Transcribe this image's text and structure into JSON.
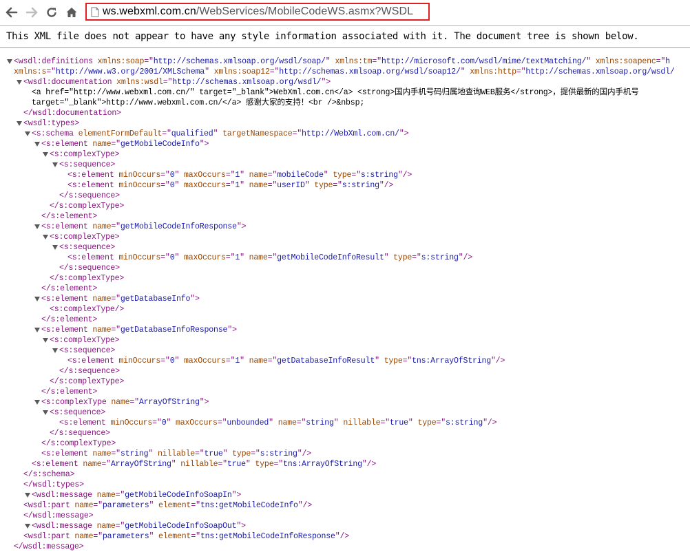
{
  "browser": {
    "url_host": "ws.webxml.com.cn",
    "url_path": "/WebServices/MobileCodeWS.asmx?WSDL",
    "back_icon": "back-arrow-icon",
    "forward_icon": "forward-arrow-icon",
    "reload_icon": "reload-icon",
    "home_icon": "home-icon",
    "highlight_color": "#e02020"
  },
  "notice": "This XML file does not appear to have any style information associated with it. The document tree is shown below.",
  "colors": {
    "tag": "#881280",
    "attr_name": "#994500",
    "attr_value": "#1a1aa6",
    "text": "#000000"
  },
  "tree": [
    {
      "tri": true,
      "parts": [
        [
          "tag",
          "<wsdl:definitions"
        ],
        [
          "tx",
          " "
        ],
        [
          "an",
          "xmlns:soap"
        ],
        [
          "tag",
          "=\""
        ],
        [
          "av",
          "http://schemas.xmlsoap.org/wsdl/soap/"
        ],
        [
          "tag",
          "\""
        ],
        [
          "tx",
          " "
        ],
        [
          "an",
          "xmlns:tm"
        ],
        [
          "tag",
          "=\""
        ],
        [
          "av",
          "http://microsoft.com/wsdl/mime/textMatching/"
        ],
        [
          "tag",
          "\""
        ],
        [
          "tx",
          " "
        ],
        [
          "an",
          "xmlns:soapenc"
        ],
        [
          "tag",
          "=\""
        ],
        [
          "av",
          "h"
        ]
      ]
    },
    {
      "tri": false,
      "parts": [
        [
          "an",
          "xmlns:s"
        ],
        [
          "tag",
          "=\""
        ],
        [
          "av",
          "http://www.w3.org/2001/XMLSchema"
        ],
        [
          "tag",
          "\""
        ],
        [
          "tx",
          " "
        ],
        [
          "an",
          "xmlns:soap12"
        ],
        [
          "tag",
          "=\""
        ],
        [
          "av",
          "http://schemas.xmlsoap.org/wsdl/soap12/"
        ],
        [
          "tag",
          "\""
        ],
        [
          "tx",
          " "
        ],
        [
          "an",
          "xmlns:http"
        ],
        [
          "tag",
          "=\""
        ],
        [
          "av",
          "http://schemas.xmlsoap.org/wsdl/"
        ]
      ]
    },
    {
      "tri": true,
      "parts": [
        [
          "tag",
          "<wsdl:documentation"
        ],
        [
          "tx",
          " "
        ],
        [
          "an",
          "xmlns:wsdl"
        ],
        [
          "tag",
          "=\""
        ],
        [
          "av",
          "http://schemas.xmlsoap.org/wsdl/"
        ],
        [
          "tag",
          "\">"
        ]
      ]
    },
    {
      "tri": false,
      "parts": [
        [
          "tx",
          "<a href=\"http://www.webxml.com.cn/\" target=\"_blank\">WebXml.com.cn</a> <strong>国内手机号码归属地查询WEB服务</strong>，提供最新的国内手机号"
        ]
      ]
    },
    {
      "tri": false,
      "parts": [
        [
          "tx",
          "target=\"_blank\">http://www.webxml.com.cn/</a> 感谢大家的支持！<br />&nbsp;"
        ]
      ]
    },
    {
      "tri": false,
      "parts": [
        [
          "tag",
          "</wsdl:documentation>"
        ]
      ]
    },
    {
      "tri": true,
      "parts": [
        [
          "tag",
          "<wsdl:types>"
        ]
      ]
    },
    {
      "tri": true,
      "parts": [
        [
          "tag",
          "<s:schema"
        ],
        [
          "tx",
          " "
        ],
        [
          "an",
          "elementFormDefault"
        ],
        [
          "tag",
          "=\""
        ],
        [
          "av",
          "qualified"
        ],
        [
          "tag",
          "\""
        ],
        [
          "tx",
          " "
        ],
        [
          "an",
          "targetNamespace"
        ],
        [
          "tag",
          "=\""
        ],
        [
          "av",
          "http://WebXml.com.cn/"
        ],
        [
          "tag",
          "\">"
        ]
      ]
    },
    {
      "tri": true,
      "parts": [
        [
          "tag",
          "<s:element"
        ],
        [
          "tx",
          " "
        ],
        [
          "an",
          "name"
        ],
        [
          "tag",
          "=\""
        ],
        [
          "av",
          "getMobileCodeInfo"
        ],
        [
          "tag",
          "\">"
        ]
      ]
    },
    {
      "tri": true,
      "parts": [
        [
          "tag",
          "<s:complexType>"
        ]
      ]
    },
    {
      "tri": true,
      "parts": [
        [
          "tag",
          "<s:sequence>"
        ]
      ]
    },
    {
      "tri": false,
      "parts": [
        [
          "tag",
          "<s:element"
        ],
        [
          "tx",
          " "
        ],
        [
          "an",
          "minOccurs"
        ],
        [
          "tag",
          "=\""
        ],
        [
          "av",
          "0"
        ],
        [
          "tag",
          "\""
        ],
        [
          "tx",
          " "
        ],
        [
          "an",
          "maxOccurs"
        ],
        [
          "tag",
          "=\""
        ],
        [
          "av",
          "1"
        ],
        [
          "tag",
          "\""
        ],
        [
          "tx",
          " "
        ],
        [
          "an",
          "name"
        ],
        [
          "tag",
          "=\""
        ],
        [
          "av",
          "mobileCode"
        ],
        [
          "tag",
          "\""
        ],
        [
          "tx",
          " "
        ],
        [
          "an",
          "type"
        ],
        [
          "tag",
          "=\""
        ],
        [
          "av",
          "s:string"
        ],
        [
          "tag",
          "\"/>"
        ]
      ]
    },
    {
      "tri": false,
      "parts": [
        [
          "tag",
          "<s:element"
        ],
        [
          "tx",
          " "
        ],
        [
          "an",
          "minOccurs"
        ],
        [
          "tag",
          "=\""
        ],
        [
          "av",
          "0"
        ],
        [
          "tag",
          "\""
        ],
        [
          "tx",
          " "
        ],
        [
          "an",
          "maxOccurs"
        ],
        [
          "tag",
          "=\""
        ],
        [
          "av",
          "1"
        ],
        [
          "tag",
          "\""
        ],
        [
          "tx",
          " "
        ],
        [
          "an",
          "name"
        ],
        [
          "tag",
          "=\""
        ],
        [
          "av",
          "userID"
        ],
        [
          "tag",
          "\""
        ],
        [
          "tx",
          " "
        ],
        [
          "an",
          "type"
        ],
        [
          "tag",
          "=\""
        ],
        [
          "av",
          "s:string"
        ],
        [
          "tag",
          "\"/>"
        ]
      ]
    },
    {
      "tri": false,
      "parts": [
        [
          "tag",
          "</s:sequence>"
        ]
      ]
    },
    {
      "tri": false,
      "parts": [
        [
          "tag",
          "</s:complexType>"
        ]
      ]
    },
    {
      "tri": false,
      "parts": [
        [
          "tag",
          "</s:element>"
        ]
      ]
    },
    {
      "tri": true,
      "parts": [
        [
          "tag",
          "<s:element"
        ],
        [
          "tx",
          " "
        ],
        [
          "an",
          "name"
        ],
        [
          "tag",
          "=\""
        ],
        [
          "av",
          "getMobileCodeInfoResponse"
        ],
        [
          "tag",
          "\">"
        ]
      ]
    },
    {
      "tri": true,
      "parts": [
        [
          "tag",
          "<s:complexType>"
        ]
      ]
    },
    {
      "tri": true,
      "parts": [
        [
          "tag",
          "<s:sequence>"
        ]
      ]
    },
    {
      "tri": false,
      "parts": [
        [
          "tag",
          "<s:element"
        ],
        [
          "tx",
          " "
        ],
        [
          "an",
          "minOccurs"
        ],
        [
          "tag",
          "=\""
        ],
        [
          "av",
          "0"
        ],
        [
          "tag",
          "\""
        ],
        [
          "tx",
          " "
        ],
        [
          "an",
          "maxOccurs"
        ],
        [
          "tag",
          "=\""
        ],
        [
          "av",
          "1"
        ],
        [
          "tag",
          "\""
        ],
        [
          "tx",
          " "
        ],
        [
          "an",
          "name"
        ],
        [
          "tag",
          "=\""
        ],
        [
          "av",
          "getMobileCodeInfoResult"
        ],
        [
          "tag",
          "\""
        ],
        [
          "tx",
          " "
        ],
        [
          "an",
          "type"
        ],
        [
          "tag",
          "=\""
        ],
        [
          "av",
          "s:string"
        ],
        [
          "tag",
          "\"/>"
        ]
      ]
    },
    {
      "tri": false,
      "parts": [
        [
          "tag",
          "</s:sequence>"
        ]
      ]
    },
    {
      "tri": false,
      "parts": [
        [
          "tag",
          "</s:complexType>"
        ]
      ]
    },
    {
      "tri": false,
      "parts": [
        [
          "tag",
          "</s:element>"
        ]
      ]
    },
    {
      "tri": true,
      "parts": [
        [
          "tag",
          "<s:element"
        ],
        [
          "tx",
          " "
        ],
        [
          "an",
          "name"
        ],
        [
          "tag",
          "=\""
        ],
        [
          "av",
          "getDatabaseInfo"
        ],
        [
          "tag",
          "\">"
        ]
      ]
    },
    {
      "tri": false,
      "parts": [
        [
          "tag",
          "<s:complexType/>"
        ]
      ]
    },
    {
      "tri": false,
      "parts": [
        [
          "tag",
          "</s:element>"
        ]
      ]
    },
    {
      "tri": true,
      "parts": [
        [
          "tag",
          "<s:element"
        ],
        [
          "tx",
          " "
        ],
        [
          "an",
          "name"
        ],
        [
          "tag",
          "=\""
        ],
        [
          "av",
          "getDatabaseInfoResponse"
        ],
        [
          "tag",
          "\">"
        ]
      ]
    },
    {
      "tri": true,
      "parts": [
        [
          "tag",
          "<s:complexType>"
        ]
      ]
    },
    {
      "tri": true,
      "parts": [
        [
          "tag",
          "<s:sequence>"
        ]
      ]
    },
    {
      "tri": false,
      "parts": [
        [
          "tag",
          "<s:element"
        ],
        [
          "tx",
          " "
        ],
        [
          "an",
          "minOccurs"
        ],
        [
          "tag",
          "=\""
        ],
        [
          "av",
          "0"
        ],
        [
          "tag",
          "\""
        ],
        [
          "tx",
          " "
        ],
        [
          "an",
          "maxOccurs"
        ],
        [
          "tag",
          "=\""
        ],
        [
          "av",
          "1"
        ],
        [
          "tag",
          "\""
        ],
        [
          "tx",
          " "
        ],
        [
          "an",
          "name"
        ],
        [
          "tag",
          "=\""
        ],
        [
          "av",
          "getDatabaseInfoResult"
        ],
        [
          "tag",
          "\""
        ],
        [
          "tx",
          " "
        ],
        [
          "an",
          "type"
        ],
        [
          "tag",
          "=\""
        ],
        [
          "av",
          "tns:ArrayOfString"
        ],
        [
          "tag",
          "\"/>"
        ]
      ]
    },
    {
      "tri": false,
      "parts": [
        [
          "tag",
          "</s:sequence>"
        ]
      ]
    },
    {
      "tri": false,
      "parts": [
        [
          "tag",
          "</s:complexType>"
        ]
      ]
    },
    {
      "tri": false,
      "parts": [
        [
          "tag",
          "</s:element>"
        ]
      ]
    },
    {
      "tri": true,
      "parts": [
        [
          "tag",
          "<s:complexType"
        ],
        [
          "tx",
          " "
        ],
        [
          "an",
          "name"
        ],
        [
          "tag",
          "=\""
        ],
        [
          "av",
          "ArrayOfString"
        ],
        [
          "tag",
          "\">"
        ]
      ]
    },
    {
      "tri": true,
      "parts": [
        [
          "tag",
          "<s:sequence>"
        ]
      ]
    },
    {
      "tri": false,
      "parts": [
        [
          "tag",
          "<s:element"
        ],
        [
          "tx",
          " "
        ],
        [
          "an",
          "minOccurs"
        ],
        [
          "tag",
          "=\""
        ],
        [
          "av",
          "0"
        ],
        [
          "tag",
          "\""
        ],
        [
          "tx",
          " "
        ],
        [
          "an",
          "maxOccurs"
        ],
        [
          "tag",
          "=\""
        ],
        [
          "av",
          "unbounded"
        ],
        [
          "tag",
          "\""
        ],
        [
          "tx",
          " "
        ],
        [
          "an",
          "name"
        ],
        [
          "tag",
          "=\""
        ],
        [
          "av",
          "string"
        ],
        [
          "tag",
          "\""
        ],
        [
          "tx",
          " "
        ],
        [
          "an",
          "nillable"
        ],
        [
          "tag",
          "=\""
        ],
        [
          "av",
          "true"
        ],
        [
          "tag",
          "\""
        ],
        [
          "tx",
          " "
        ],
        [
          "an",
          "type"
        ],
        [
          "tag",
          "=\""
        ],
        [
          "av",
          "s:string"
        ],
        [
          "tag",
          "\"/>"
        ]
      ]
    },
    {
      "tri": false,
      "parts": [
        [
          "tag",
          "</s:sequence>"
        ]
      ]
    },
    {
      "tri": false,
      "parts": [
        [
          "tag",
          "</s:complexType>"
        ]
      ]
    },
    {
      "tri": false,
      "parts": [
        [
          "tag",
          "<s:element"
        ],
        [
          "tx",
          " "
        ],
        [
          "an",
          "name"
        ],
        [
          "tag",
          "=\""
        ],
        [
          "av",
          "string"
        ],
        [
          "tag",
          "\""
        ],
        [
          "tx",
          " "
        ],
        [
          "an",
          "nillable"
        ],
        [
          "tag",
          "=\""
        ],
        [
          "av",
          "true"
        ],
        [
          "tag",
          "\""
        ],
        [
          "tx",
          " "
        ],
        [
          "an",
          "type"
        ],
        [
          "tag",
          "=\""
        ],
        [
          "av",
          "s:string"
        ],
        [
          "tag",
          "\"/>"
        ]
      ]
    },
    {
      "tri": false,
      "parts": [
        [
          "tag",
          "<s:element"
        ],
        [
          "tx",
          " "
        ],
        [
          "an",
          "name"
        ],
        [
          "tag",
          "=\""
        ],
        [
          "av",
          "ArrayOfString"
        ],
        [
          "tag",
          "\""
        ],
        [
          "tx",
          " "
        ],
        [
          "an",
          "nillable"
        ],
        [
          "tag",
          "=\""
        ],
        [
          "av",
          "true"
        ],
        [
          "tag",
          "\""
        ],
        [
          "tx",
          " "
        ],
        [
          "an",
          "type"
        ],
        [
          "tag",
          "=\""
        ],
        [
          "av",
          "tns:ArrayOfString"
        ],
        [
          "tag",
          "\"/>"
        ]
      ]
    },
    {
      "tri": false,
      "parts": [
        [
          "tag",
          "</s:schema>"
        ]
      ]
    },
    {
      "tri": false,
      "parts": [
        [
          "tag",
          "</wsdl:types>"
        ]
      ]
    },
    {
      "tri": true,
      "parts": [
        [
          "tag",
          "<wsdl:message"
        ],
        [
          "tx",
          " "
        ],
        [
          "an",
          "name"
        ],
        [
          "tag",
          "=\""
        ],
        [
          "av",
          "getMobileCodeInfoSoapIn"
        ],
        [
          "tag",
          "\">"
        ]
      ]
    },
    {
      "tri": false,
      "parts": [
        [
          "tag",
          "<wsdl:part"
        ],
        [
          "tx",
          " "
        ],
        [
          "an",
          "name"
        ],
        [
          "tag",
          "=\""
        ],
        [
          "av",
          "parameters"
        ],
        [
          "tag",
          "\""
        ],
        [
          "tx",
          " "
        ],
        [
          "an",
          "element"
        ],
        [
          "tag",
          "=\""
        ],
        [
          "av",
          "tns:getMobileCodeInfo"
        ],
        [
          "tag",
          "\"/>"
        ]
      ]
    },
    {
      "tri": false,
      "parts": [
        [
          "tag",
          "</wsdl:message>"
        ]
      ]
    },
    {
      "tri": true,
      "parts": [
        [
          "tag",
          "<wsdl:message"
        ],
        [
          "tx",
          " "
        ],
        [
          "an",
          "name"
        ],
        [
          "tag",
          "=\""
        ],
        [
          "av",
          "getMobileCodeInfoSoapOut"
        ],
        [
          "tag",
          "\">"
        ]
      ]
    },
    {
      "tri": false,
      "parts": [
        [
          "tag",
          "<wsdl:part"
        ],
        [
          "tx",
          " "
        ],
        [
          "an",
          "name"
        ],
        [
          "tag",
          "=\""
        ],
        [
          "av",
          "parameters"
        ],
        [
          "tag",
          "\""
        ],
        [
          "tx",
          " "
        ],
        [
          "an",
          "element"
        ],
        [
          "tag",
          "=\""
        ],
        [
          "av",
          "tns:getMobileCodeInfoResponse"
        ],
        [
          "tag",
          "\"/>"
        ]
      ]
    },
    {
      "tri": false,
      "parts": [
        [
          "tag",
          "</wsdl:message>"
        ]
      ]
    }
  ]
}
